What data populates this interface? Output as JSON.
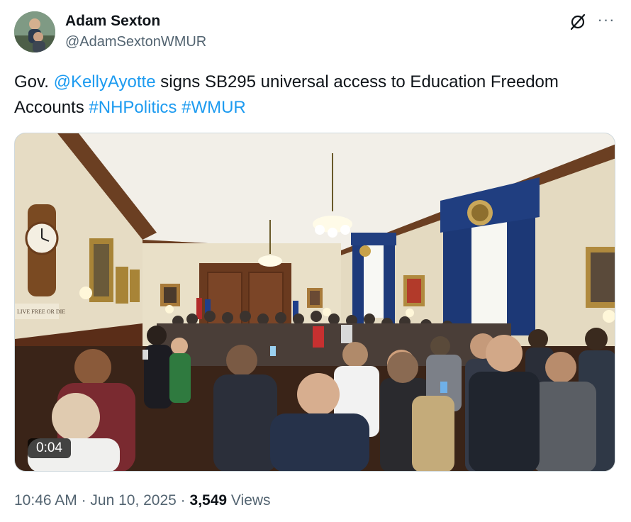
{
  "author": {
    "display_name": "Adam Sexton",
    "handle": "@AdamSextonWMUR",
    "avatar_icon": "avatar-photo"
  },
  "header_actions": {
    "grok_icon": "grok-icon",
    "more_icon": "more-icon",
    "more_glyph": "···"
  },
  "tweet": {
    "text_part1": "Gov. ",
    "mention": "@KellyAyotte",
    "text_part2": " signs SB295 universal access to Education Freedom Accounts ",
    "hashtag1": "#NHPolitics",
    "text_space": " ",
    "hashtag2": "#WMUR"
  },
  "media": {
    "type": "video",
    "duration": "0:04",
    "sign_text": "LIVE FREE OR DIE"
  },
  "meta": {
    "time": "10:46 AM",
    "separator1": " · ",
    "date": "Jun 10, 2025",
    "separator2": " · ",
    "views_count": "3,549",
    "views_label": " Views"
  },
  "colors": {
    "link": "#1d9bf0",
    "secondary": "#536471",
    "primary": "#0f1419"
  }
}
